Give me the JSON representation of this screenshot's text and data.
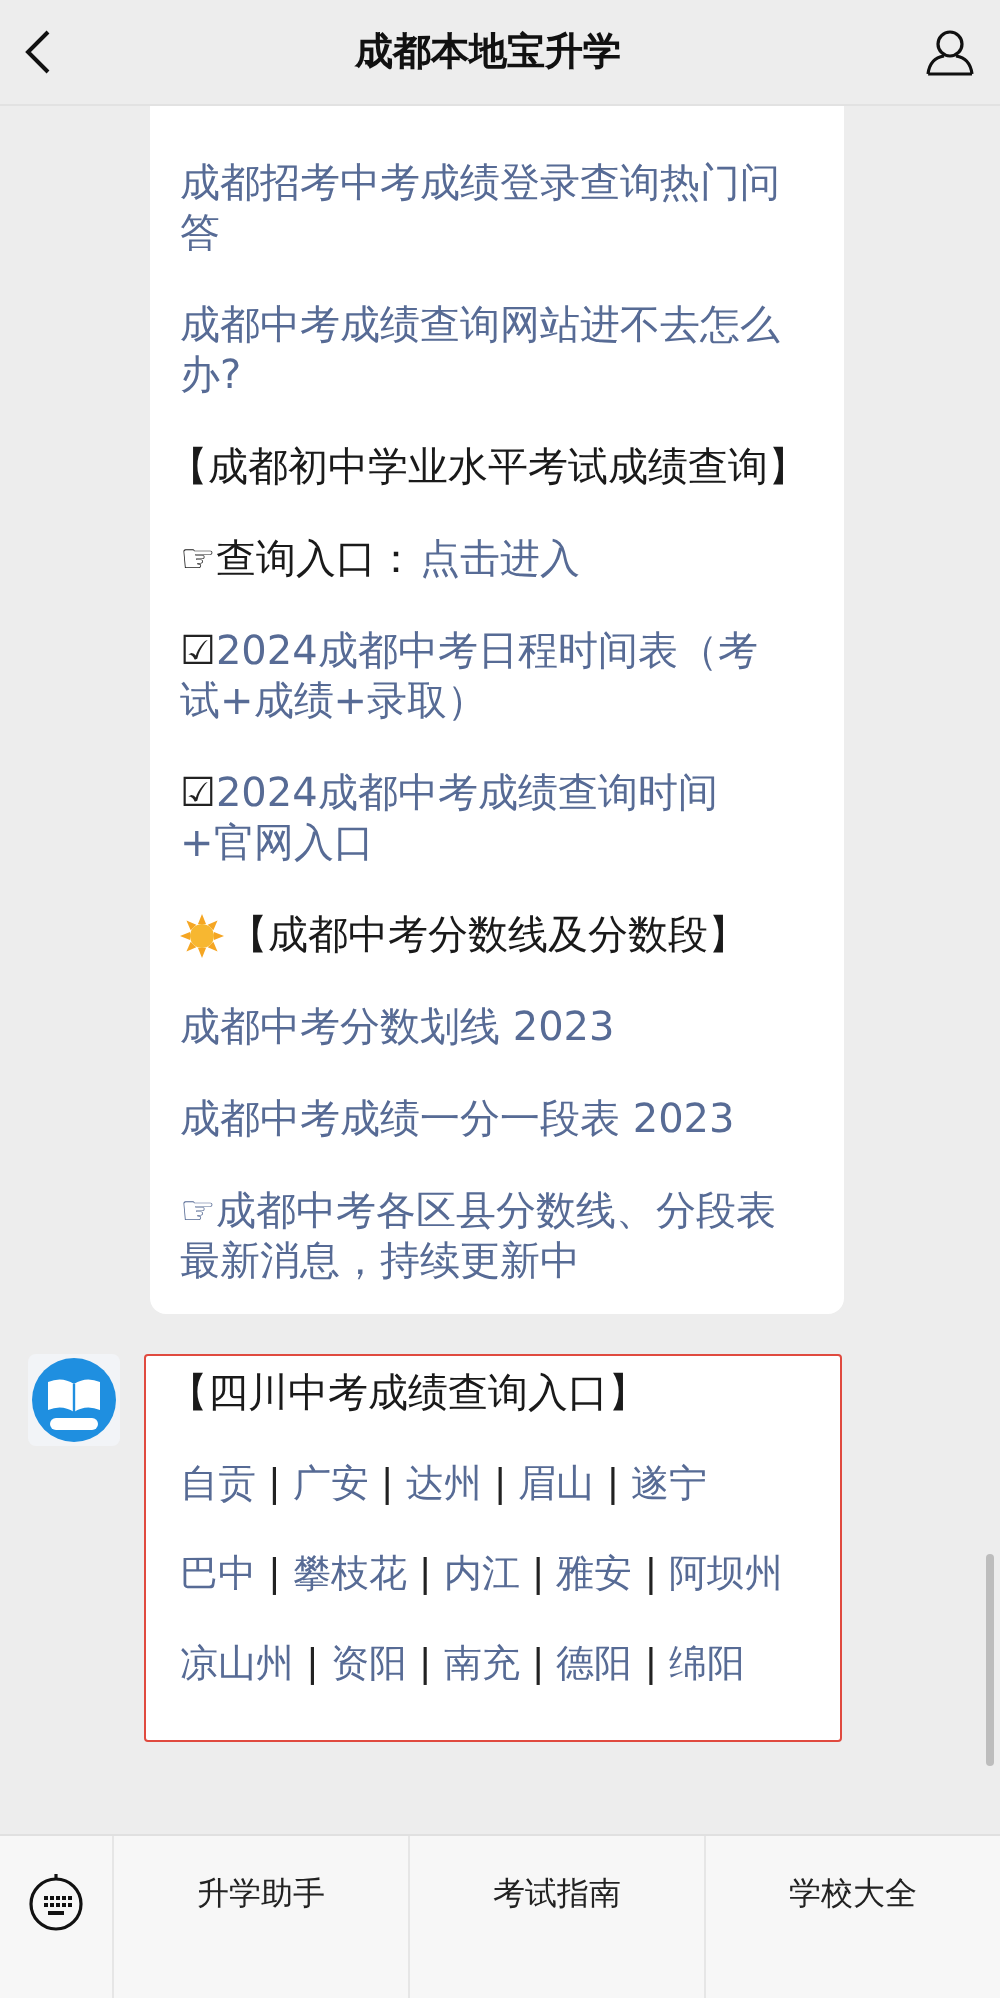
{
  "header": {
    "title": "成都本地宝升学"
  },
  "messages": [
    {
      "highlighted": false,
      "avatar": false,
      "items": [
        {
          "kind": "link",
          "text": "成都招考中考成绩登录查询热门问答"
        },
        {
          "kind": "link",
          "text": "成都中考成绩查询网站进不去怎么办?"
        },
        {
          "kind": "heading",
          "text": "【成都初中学业水平考试成绩查询】"
        },
        {
          "kind": "entry",
          "label": "☞查询入口：",
          "link": "点击进入"
        },
        {
          "kind": "link",
          "marker": "☑",
          "text": "2024成都中考日程时间表（考试+成绩+录取）"
        },
        {
          "kind": "link",
          "marker": "☑",
          "text": "2024成都中考成绩查询时间+官网入口"
        },
        {
          "kind": "sun-heading",
          "text": "【成都中考分数线及分数段】"
        },
        {
          "kind": "link",
          "text": "成都中考分数划线 2023"
        },
        {
          "kind": "link",
          "text": "成都中考成绩一分一段表 2023"
        },
        {
          "kind": "link",
          "text": "☞成都中考各区县分数线、分段表最新消息，持续更新中"
        }
      ]
    },
    {
      "highlighted": true,
      "avatar": true,
      "items": [
        {
          "kind": "heading",
          "text": "【四川中考成绩查询入口】"
        },
        {
          "kind": "cities",
          "parts": [
            {
              "kind": "city",
              "text": "自贡"
            },
            {
              "kind": "sep",
              "text": "|"
            },
            {
              "kind": "city",
              "text": "广安"
            },
            {
              "kind": "sep",
              "text": "|"
            },
            {
              "kind": "city",
              "text": "达州"
            },
            {
              "kind": "sep",
              "text": "|"
            },
            {
              "kind": "city",
              "text": "眉山"
            },
            {
              "kind": "sep",
              "text": "|"
            },
            {
              "kind": "city",
              "text": "遂宁"
            }
          ]
        },
        {
          "kind": "cities",
          "parts": [
            {
              "kind": "city",
              "text": "巴中"
            },
            {
              "kind": "sep",
              "text": "|"
            },
            {
              "kind": "city",
              "text": "攀枝花"
            },
            {
              "kind": "sep",
              "text": "|"
            },
            {
              "kind": "city",
              "text": "内江"
            },
            {
              "kind": "sep",
              "text": "|"
            },
            {
              "kind": "city",
              "text": "雅安"
            },
            {
              "kind": "sep",
              "text": "|"
            },
            {
              "kind": "city",
              "text": "阿坝州"
            }
          ]
        },
        {
          "kind": "cities",
          "parts": [
            {
              "kind": "city",
              "text": "凉山州"
            },
            {
              "kind": "sep",
              "text": "|"
            },
            {
              "kind": "city",
              "text": "资阳"
            },
            {
              "kind": "sep",
              "text": "|"
            },
            {
              "kind": "city",
              "text": "南充"
            },
            {
              "kind": "sep",
              "text": "|"
            },
            {
              "kind": "city",
              "text": "德阳"
            },
            {
              "kind": "sep",
              "text": "|"
            },
            {
              "kind": "city",
              "text": "绵阳"
            }
          ]
        }
      ]
    }
  ],
  "menu": [
    "升学助手",
    "考试指南",
    "学校大全"
  ]
}
